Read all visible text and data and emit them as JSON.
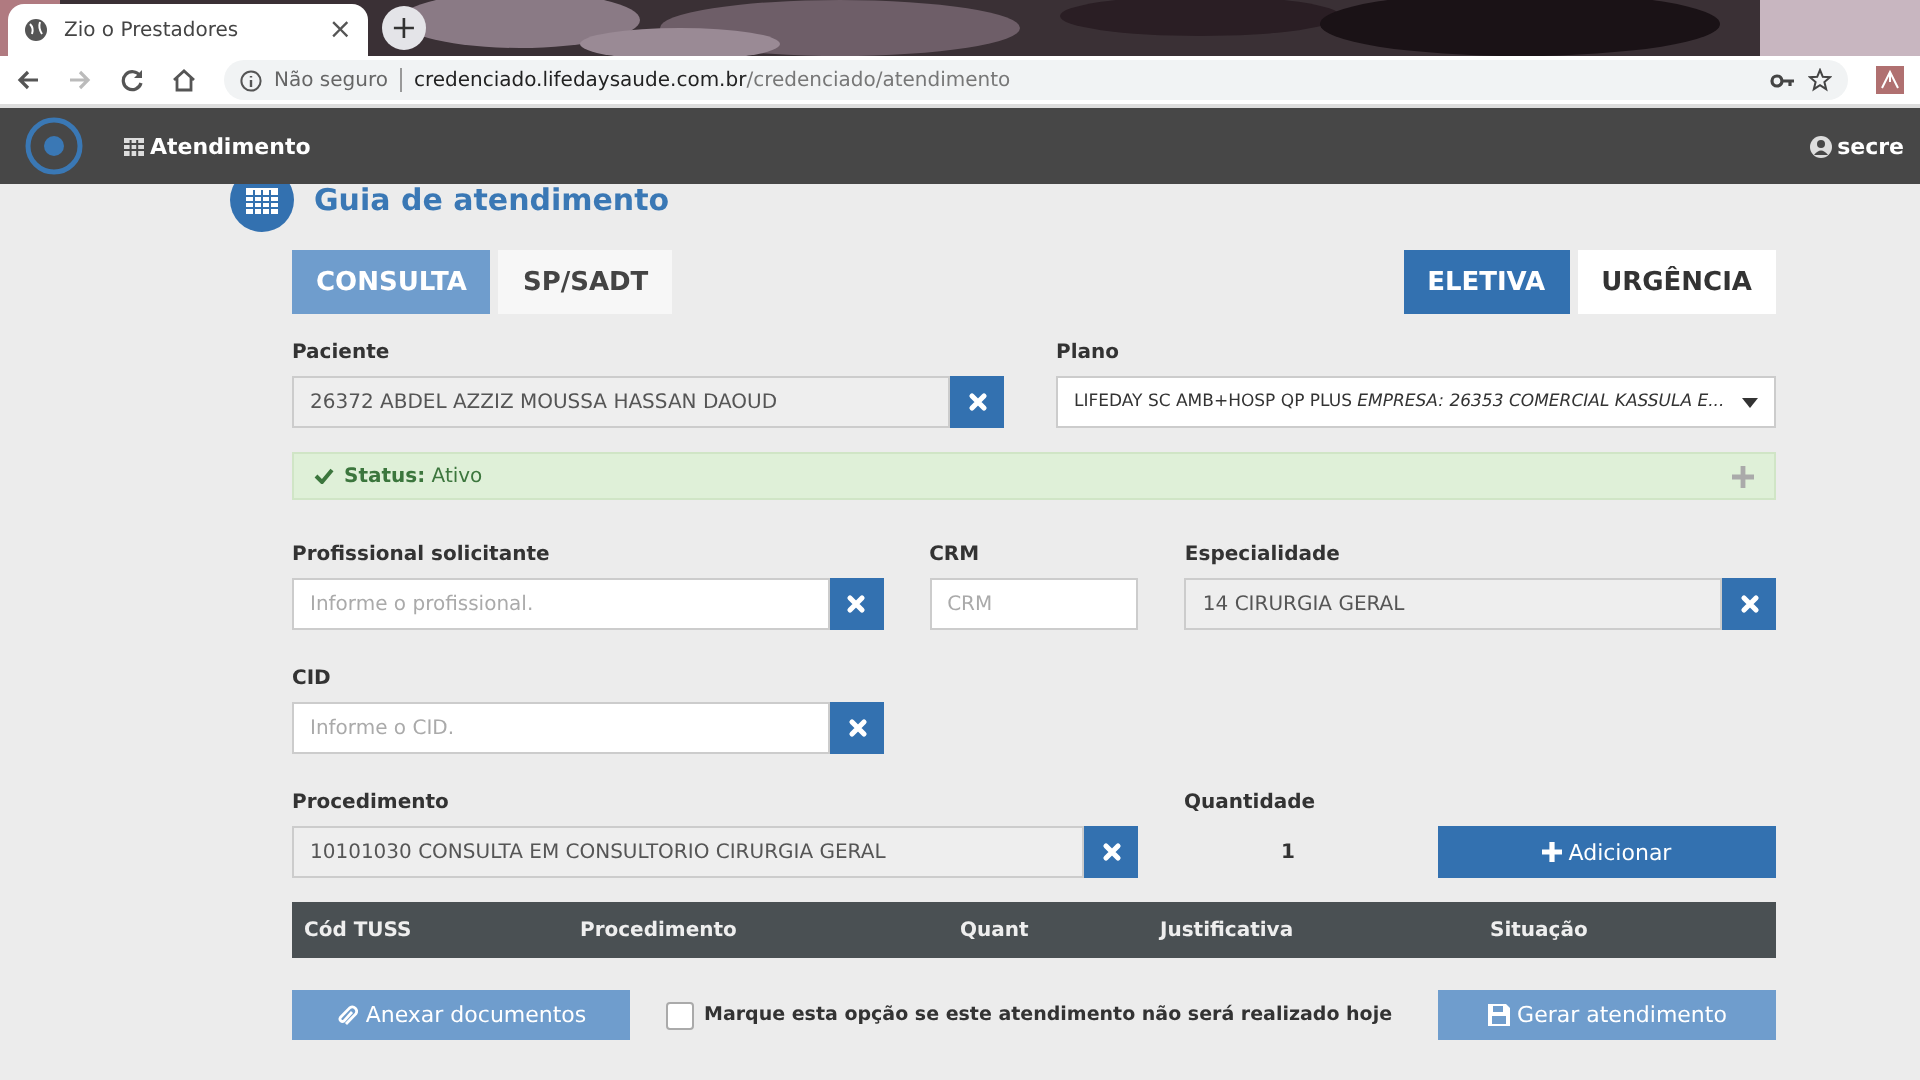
{
  "browser": {
    "tab_title": "Zio o Prestadores",
    "tab_close": "×",
    "new_tab": "+",
    "security": "Não seguro",
    "url_host": "credenciado.lifedaysaude.com.br",
    "url_path": "/credenciado/atendimento"
  },
  "navbar": {
    "menu": "Atendimento",
    "user": "secre"
  },
  "page_title": "Guia de atendimento",
  "type_tabs": [
    {
      "label": "CONSULTA",
      "selected": true
    },
    {
      "label": "SP/SADT",
      "selected": false
    }
  ],
  "mode_tabs": [
    {
      "label": "ELETIVA",
      "selected": true
    },
    {
      "label": "URGÊNCIA",
      "selected": false
    }
  ],
  "paciente": {
    "label": "Paciente",
    "value": "26372 ABDEL AZZIZ MOUSSA HASSAN DAOUD"
  },
  "plano": {
    "label": "Plano",
    "value": "LIFEDAY SC AMB+HOSP QP PLUS *EMPRESA: 26353 COMERCIAL KASSULA E...*"
  },
  "status": "**Status:** Ativo",
  "profissional": {
    "label": "Profissional solicitante",
    "placeholder": "Informe o profissional."
  },
  "crm": {
    "label": "CRM",
    "placeholder": "CRM"
  },
  "especialidade": {
    "label": "Especialidade",
    "value": "14 CIRURGIA GERAL"
  },
  "cid": {
    "label": "CID",
    "placeholder": "Informe o CID."
  },
  "procedimento": {
    "label": "Procedimento",
    "value": "10101030 CONSULTA EM CONSULTORIO   CIRURGIA GERAL"
  },
  "quantidade": {
    "label": "Quantidade",
    "value": "1"
  },
  "add_button": "Adicionar",
  "table": {
    "columns": [
      "Cód TUSS",
      "Procedimento",
      "Quant",
      "Justificativa",
      "Situação"
    ]
  },
  "attach_button": "Anexar documentos",
  "not_today": {
    "label": "Marque esta opção se este atendimento não será realizado hoje",
    "checked": false
  },
  "submit_button": "Gerar atendimento"
}
